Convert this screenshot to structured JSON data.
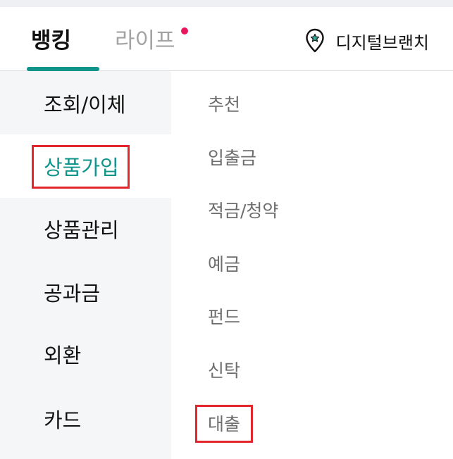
{
  "header": {
    "tabs": [
      {
        "label": "뱅킹",
        "selected": true
      },
      {
        "label": "라이프",
        "selected": false,
        "has_new_badge": true
      }
    ],
    "branch_label": "디지털브랜치",
    "branch_icon": "location-pin-star-icon"
  },
  "left_menu": {
    "items": [
      {
        "label": "조회/이체",
        "active": false
      },
      {
        "label": "상품가입",
        "active": true
      },
      {
        "label": "상품관리",
        "active": false
      },
      {
        "label": "공과금",
        "active": false
      },
      {
        "label": "외환",
        "active": false
      },
      {
        "label": "카드",
        "active": false
      }
    ]
  },
  "right_menu": {
    "items": [
      {
        "label": "추천"
      },
      {
        "label": "입출금"
      },
      {
        "label": "적금/청약"
      },
      {
        "label": "예금"
      },
      {
        "label": "펀드"
      },
      {
        "label": "신탁"
      },
      {
        "label": "대출"
      }
    ]
  },
  "colors": {
    "accent": "#0f948b",
    "highlight_box": "#e3262c",
    "badge": "#e8175d"
  }
}
